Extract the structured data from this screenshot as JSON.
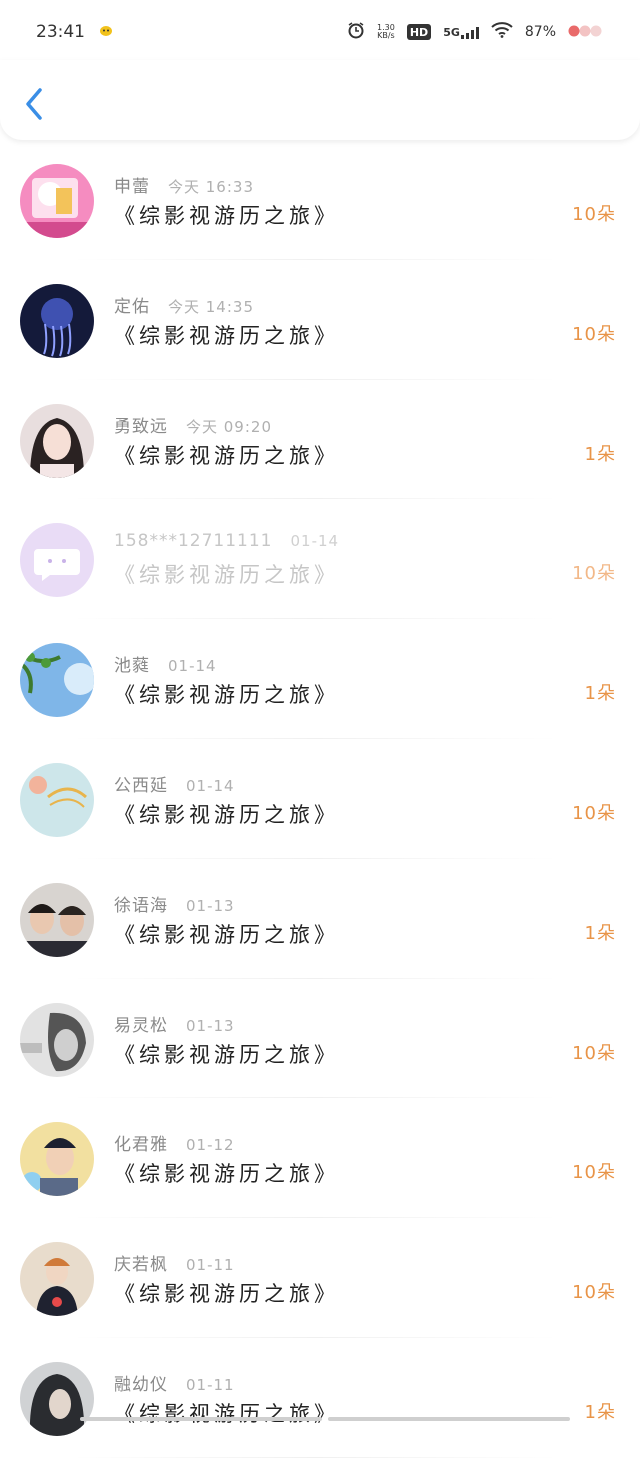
{
  "status": {
    "time": "23:41",
    "net_speed_value": "1.30",
    "net_speed_unit": "KB/s",
    "hd": "HD",
    "signal": "5G",
    "battery": "87%"
  },
  "colors": {
    "accent": "#3a8ee6",
    "count": "#e89448"
  },
  "list": [
    {
      "name": "申蕾",
      "time": "今天 16:33",
      "title": "《综影视游历之旅》",
      "count": "10朵"
    },
    {
      "name": "定佑",
      "time": "今天 14:35",
      "title": "《综影视游历之旅》",
      "count": "10朵"
    },
    {
      "name": "勇致远",
      "time": "今天 09:20",
      "title": "《综影视游历之旅》",
      "count": "1朵"
    },
    {
      "name": "158***12711111",
      "time": "01-14",
      "title": "《综影视游历之旅》",
      "count": "10朵"
    },
    {
      "name": "池蕤",
      "time": "01-14",
      "title": "《综影视游历之旅》",
      "count": "1朵"
    },
    {
      "name": "公西延",
      "time": "01-14",
      "title": "《综影视游历之旅》",
      "count": "10朵"
    },
    {
      "name": "徐语海",
      "time": "01-13",
      "title": "《综影视游历之旅》",
      "count": "1朵"
    },
    {
      "name": "易灵松",
      "time": "01-13",
      "title": "《综影视游历之旅》",
      "count": "10朵"
    },
    {
      "name": "化君雅",
      "time": "01-12",
      "title": "《综影视游历之旅》",
      "count": "10朵"
    },
    {
      "name": "庆若枫",
      "time": "01-11",
      "title": "《综影视游历之旅》",
      "count": "10朵"
    },
    {
      "name": "融幼仪",
      "time": "01-11",
      "title": "《综影视游历之旅》",
      "count": "1朵"
    }
  ]
}
